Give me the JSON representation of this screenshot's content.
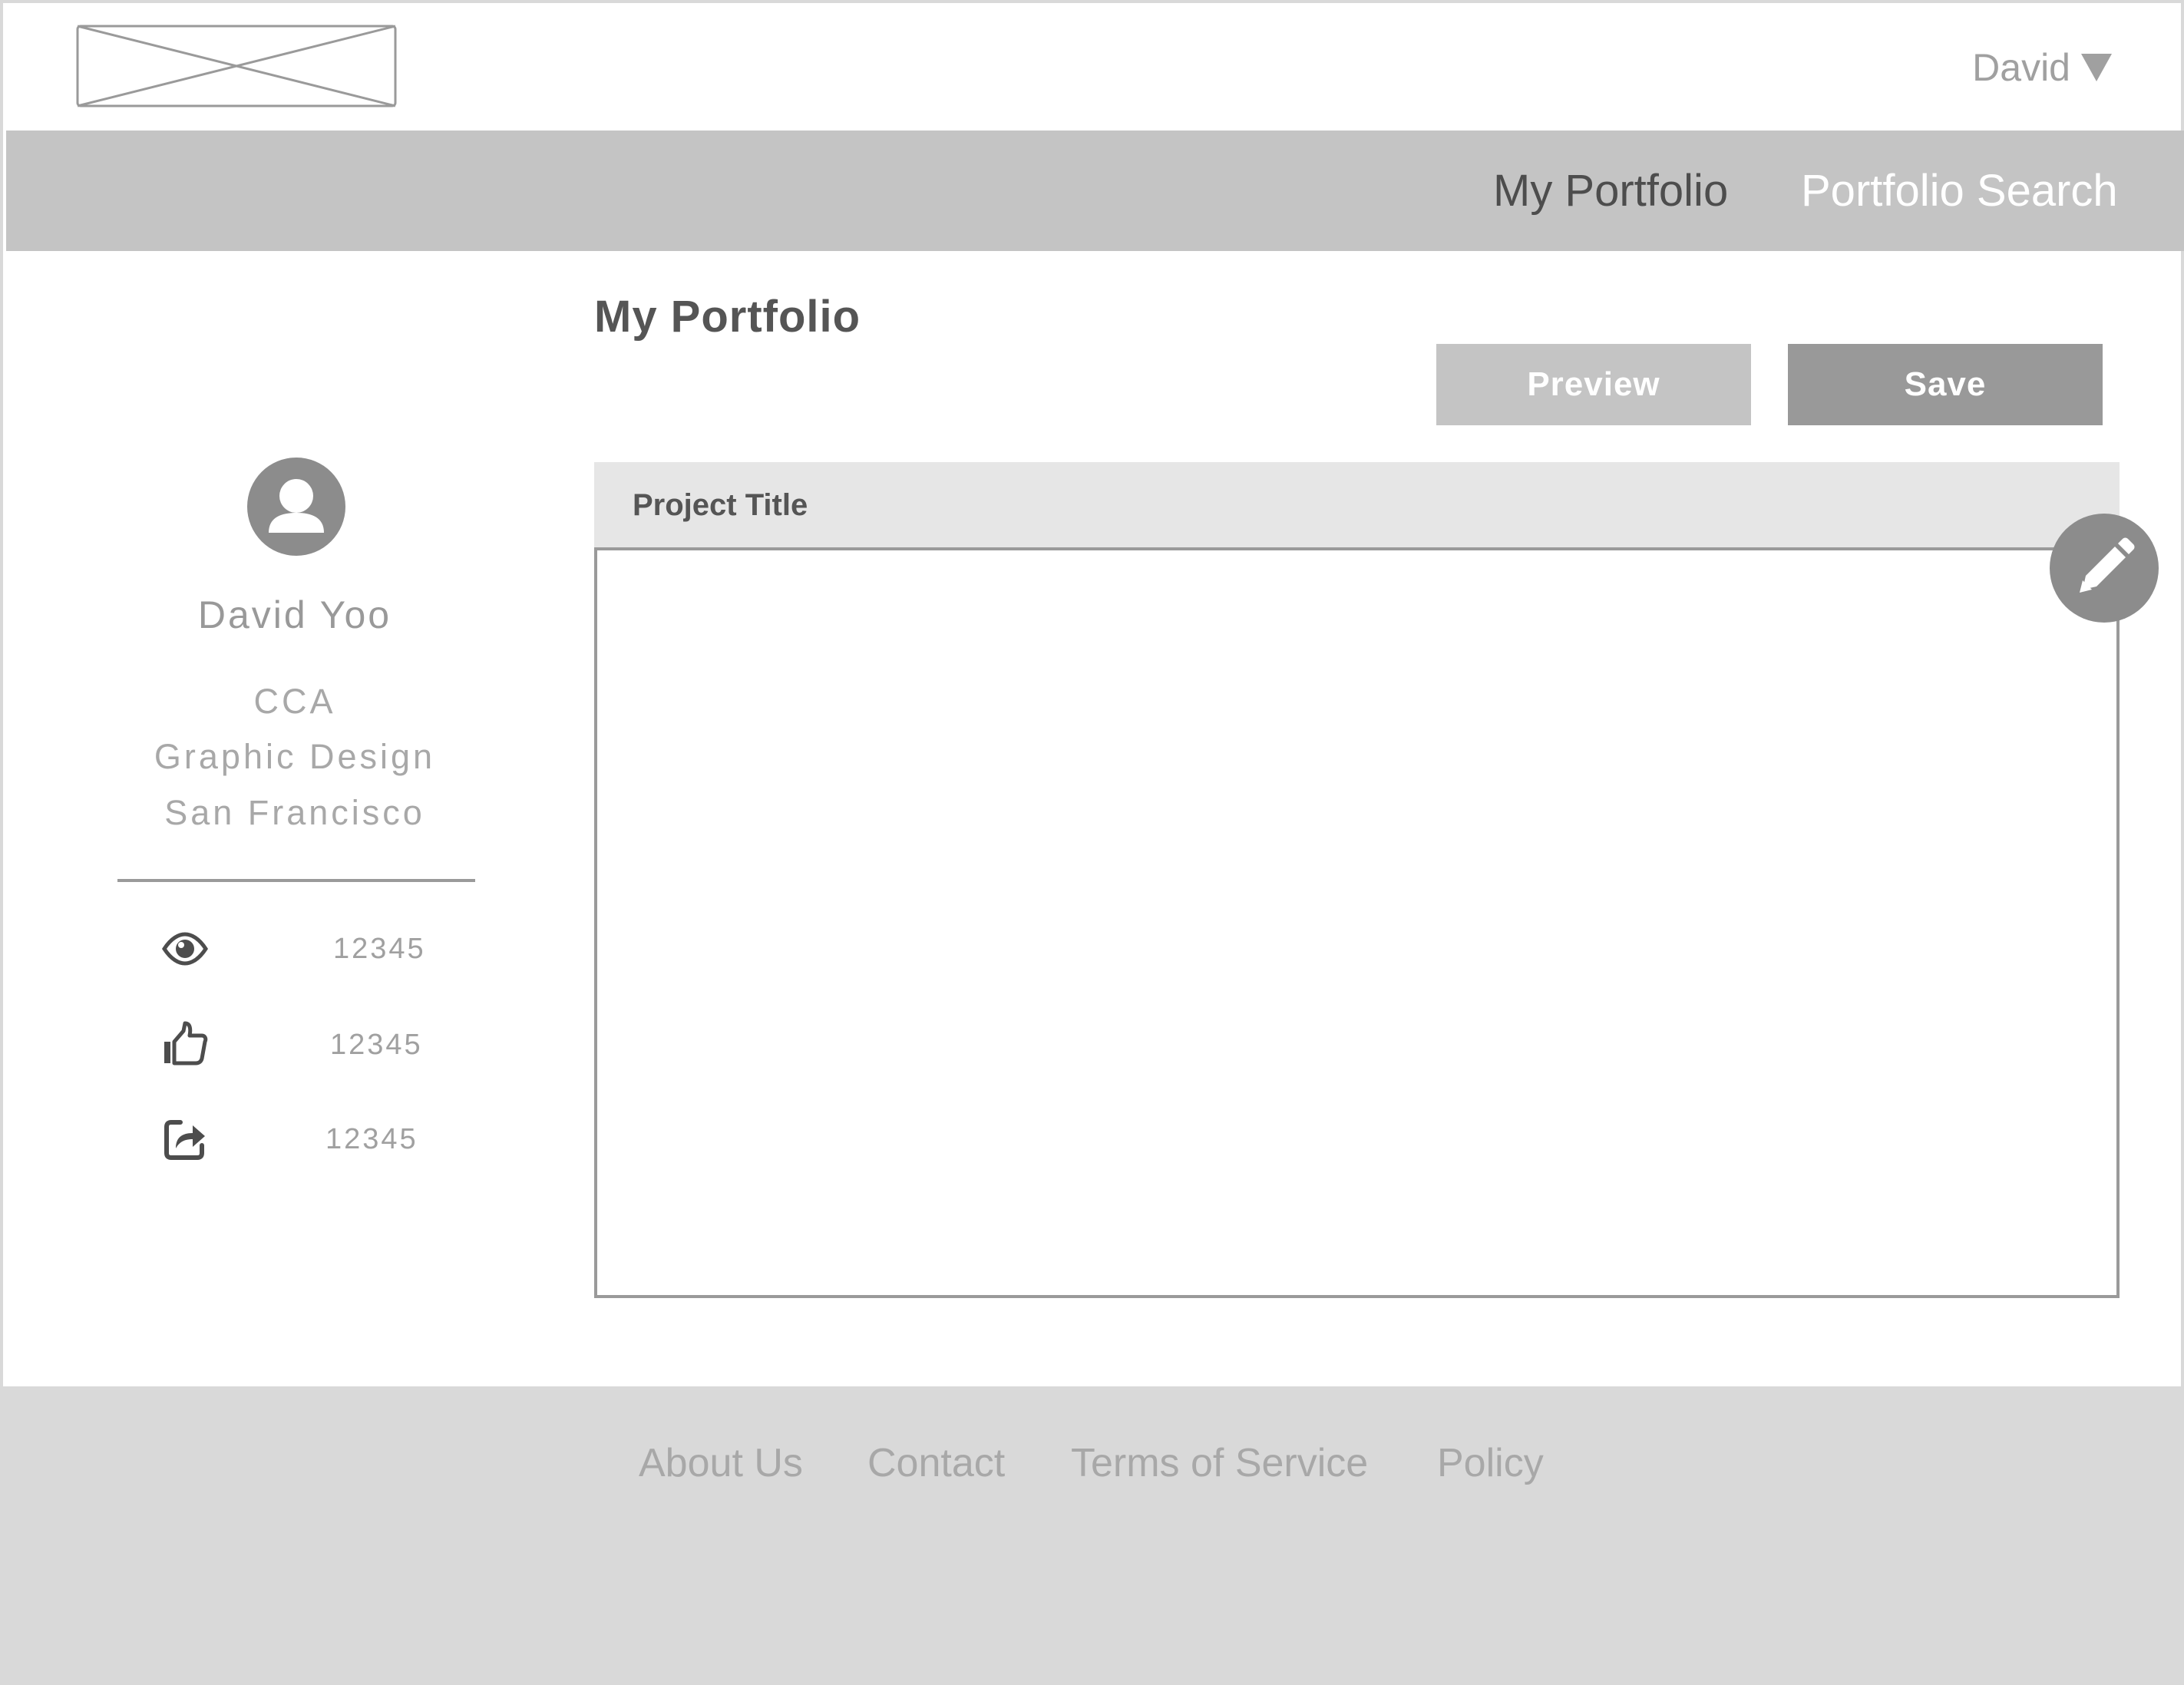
{
  "header": {
    "user_name": "David"
  },
  "nav": {
    "items": [
      {
        "label": "My Portfolio",
        "active": true
      },
      {
        "label": "Portfolio Search",
        "active": false
      }
    ]
  },
  "main": {
    "title": "My Portfolio",
    "preview_label": "Preview",
    "save_label": "Save",
    "project_title": "Project Title"
  },
  "profile": {
    "name": "David Yoo",
    "school": "CCA",
    "major": "Graphic Design",
    "location": "San Francisco",
    "stats": [
      {
        "icon": "eye-icon",
        "value": "12345"
      },
      {
        "icon": "thumbs-up-icon",
        "value": "12345"
      },
      {
        "icon": "share-icon",
        "value": "12345"
      }
    ]
  },
  "footer": {
    "links": [
      "About Us",
      "Contact",
      "Terms of Service",
      "Policy"
    ]
  },
  "colors": {
    "navbar_bg": "#c4c4c4",
    "preview_bg": "#c4c4c4",
    "save_bg": "#999999",
    "footer_bg": "#d9d9d9",
    "card_header_bg": "#e6e6e6"
  }
}
